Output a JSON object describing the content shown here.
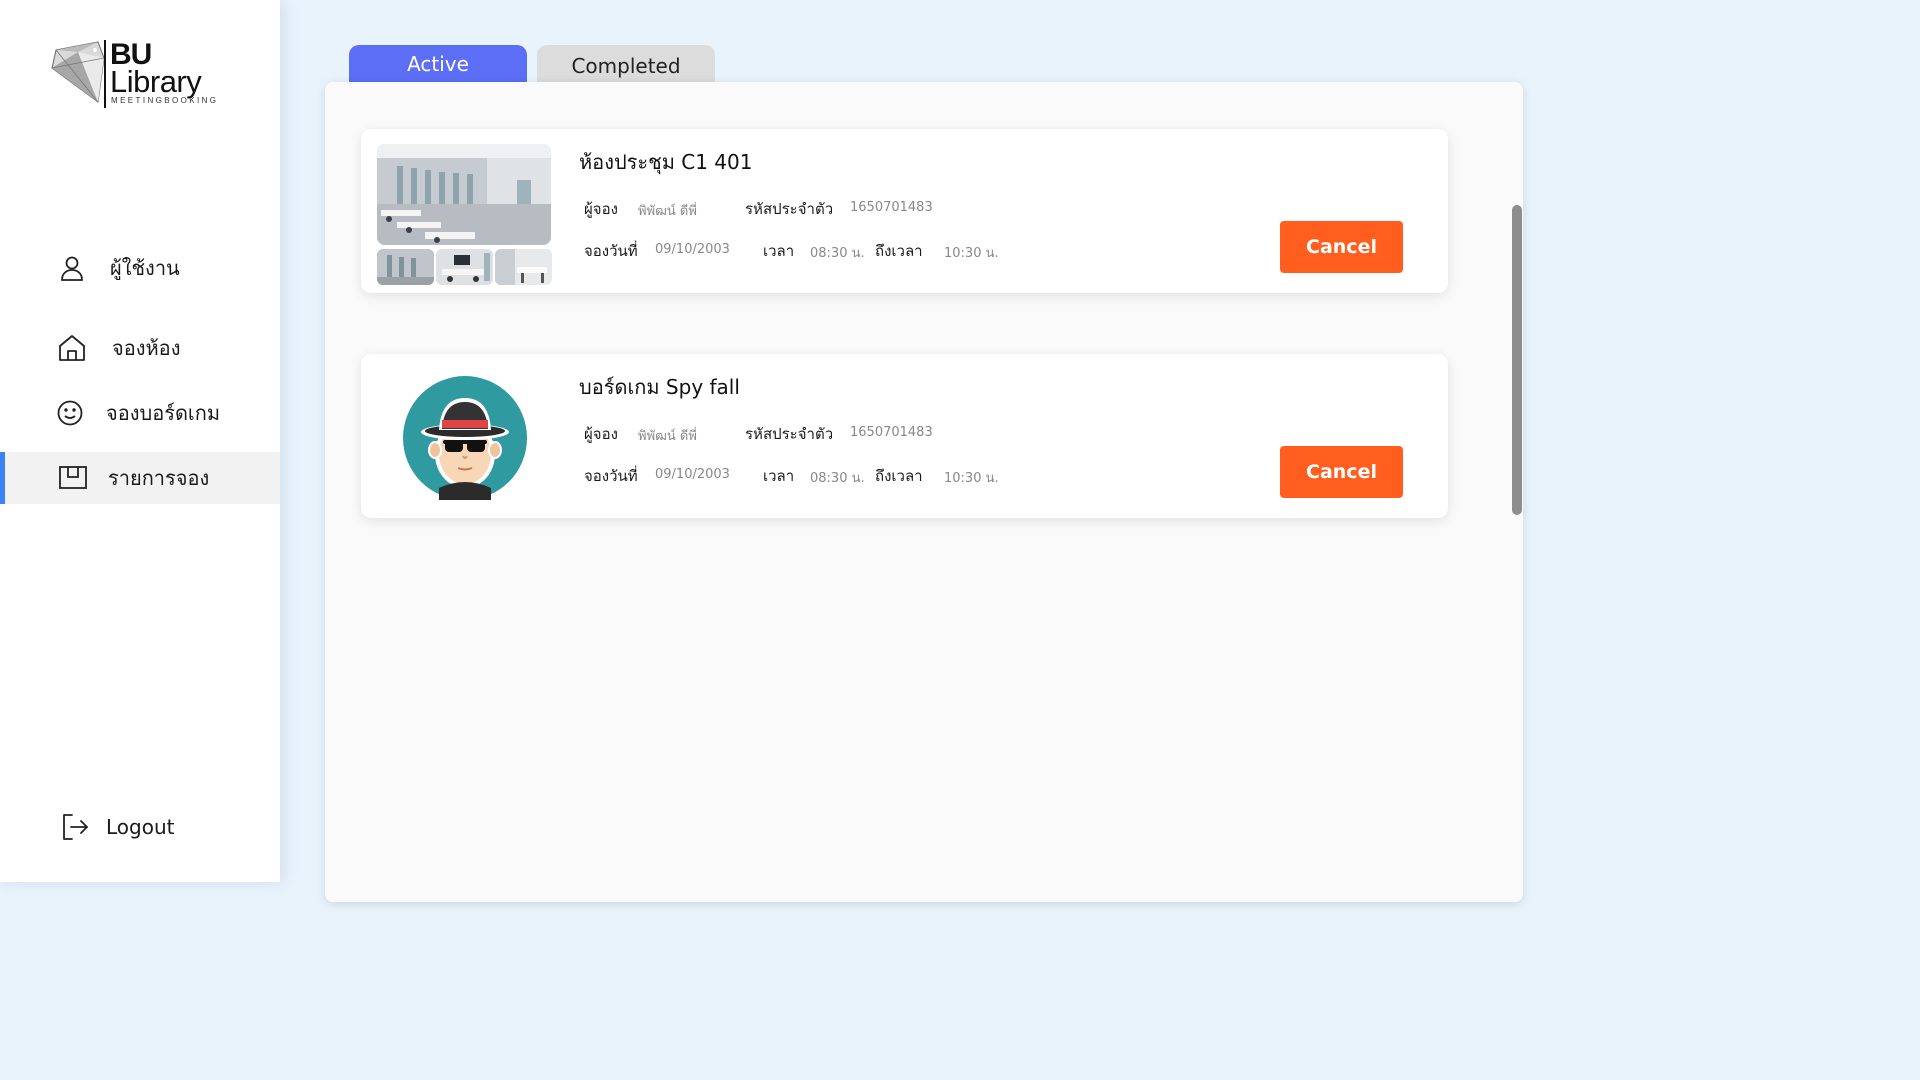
{
  "sidebar": {
    "logo": {
      "top": "BU",
      "main": "Library",
      "sub": "MEETINGBOOKING"
    },
    "items": [
      {
        "label": "ผู้ใช้งาน",
        "icon": "user-icon"
      },
      {
        "label": "จองห้อง",
        "icon": "home-icon"
      },
      {
        "label": "จองบอร์ดเกม",
        "icon": "smiley-icon"
      },
      {
        "label": "รายการจอง",
        "icon": "booking-list-icon"
      }
    ],
    "logout": {
      "label": "Logout",
      "icon": "logout-icon"
    }
  },
  "tabs": [
    {
      "label": "Active",
      "selected": true
    },
    {
      "label": "Completed",
      "selected": false
    }
  ],
  "labels": {
    "booker": "ผู้จอง",
    "student_id": "รหัสประจำตัว",
    "date": "จองวันที่",
    "time": "เวลา",
    "until": "ถึงเวลา",
    "cancel": "Cancel"
  },
  "bookings": [
    {
      "title": "ห้องประชุม C1 401",
      "booker": "พิพัฒน์   ดีพี่",
      "student_id": "1650701483",
      "date": "09/10/2003",
      "time": "08:30 น.",
      "until": "10:30 น.",
      "image": "meeting-room-photo"
    },
    {
      "title": "บอร์ดเกม Spy fall",
      "booker": "พิพัฒน์   ดีพี่",
      "student_id": "1650701483",
      "date": "09/10/2003",
      "time": "08:30 น.",
      "until": "10:30 น.",
      "image": "spy-avatar"
    }
  ],
  "colors": {
    "accent_tab": "#5b6ef5",
    "cancel": "#ff5e1f",
    "active_indicator": "#3b82f6",
    "background": "#e9f3fc"
  }
}
